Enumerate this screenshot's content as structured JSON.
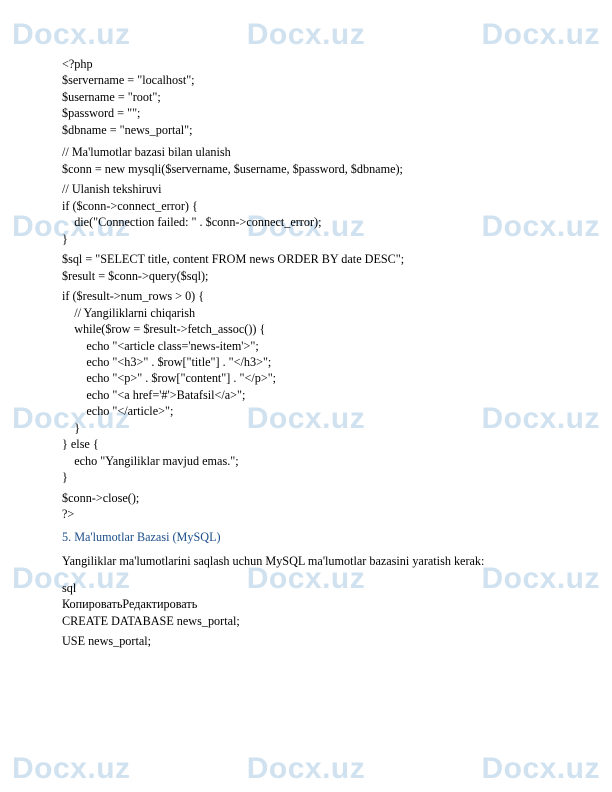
{
  "watermark": "Docx.uz",
  "code1": "<?php\n$servername = \"localhost\";\n$username = \"root\";\n$password = \"\";\n$dbname = \"news_portal\";",
  "code2": "// Ma'lumotlar bazasi bilan ulanish\n$conn = new mysqli($servername, $username, $password, $dbname);",
  "code3": "// Ulanish tekshiruvi\nif ($conn->connect_error) {\n    die(\"Connection failed: \" . $conn->connect_error);\n}",
  "code4": "$sql = \"SELECT title, content FROM news ORDER BY date DESC\";\n$result = $conn->query($sql);",
  "code5": "if ($result->num_rows > 0) {\n    // Yangiliklarni chiqarish\n    while($row = $result->fetch_assoc()) {\n        echo \"<article class='news-item'>\";\n        echo \"<h3>\" . $row[\"title\"] . \"</h3>\";\n        echo \"<p>\" . $row[\"content\"] . \"</p>\";\n        echo \"<a href='#'>Batafsil</a>\";\n        echo \"</article>\";\n    }\n} else {\n    echo \"Yangiliklar mavjud emas.\";\n}",
  "code6": "$conn->close();\n?>",
  "section_title": "5. Ma'lumotlar Bazasi (MySQL)",
  "description": "Yangiliklar ma'lumotlarini saqlash uchun MySQL ma'lumotlar bazasini yaratish kerak:",
  "code7": "sql\nКопироватьРедактировать\nCREATE DATABASE news_portal;",
  "code8": "USE news_portal;"
}
